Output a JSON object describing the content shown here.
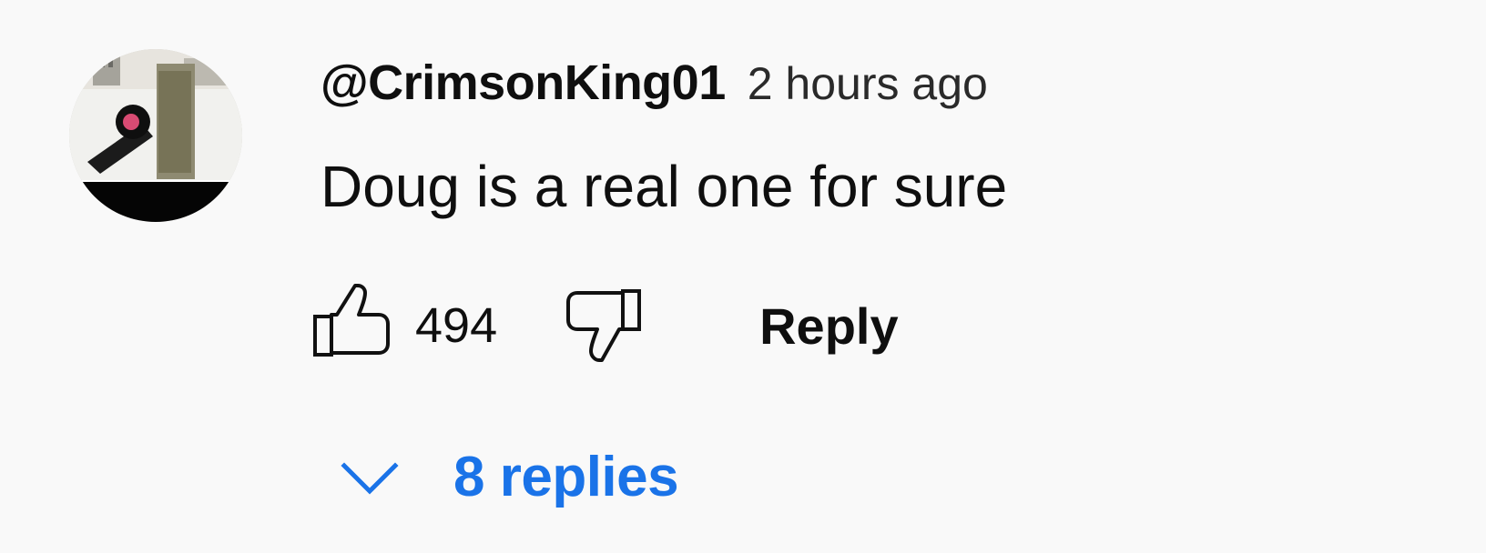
{
  "comment": {
    "author": "@CrimsonKing01",
    "timestamp": "2 hours ago",
    "text": "Doug is a real one for sure",
    "likes": "494",
    "reply_label": "Reply",
    "replies_label": "8 replies",
    "avatar_icon": "avatar-image",
    "like_icon": "thumbs-up-icon",
    "dislike_icon": "thumbs-down-icon",
    "replies_icon": "chevron-down-icon",
    "accent_color": "#1a73e8"
  }
}
